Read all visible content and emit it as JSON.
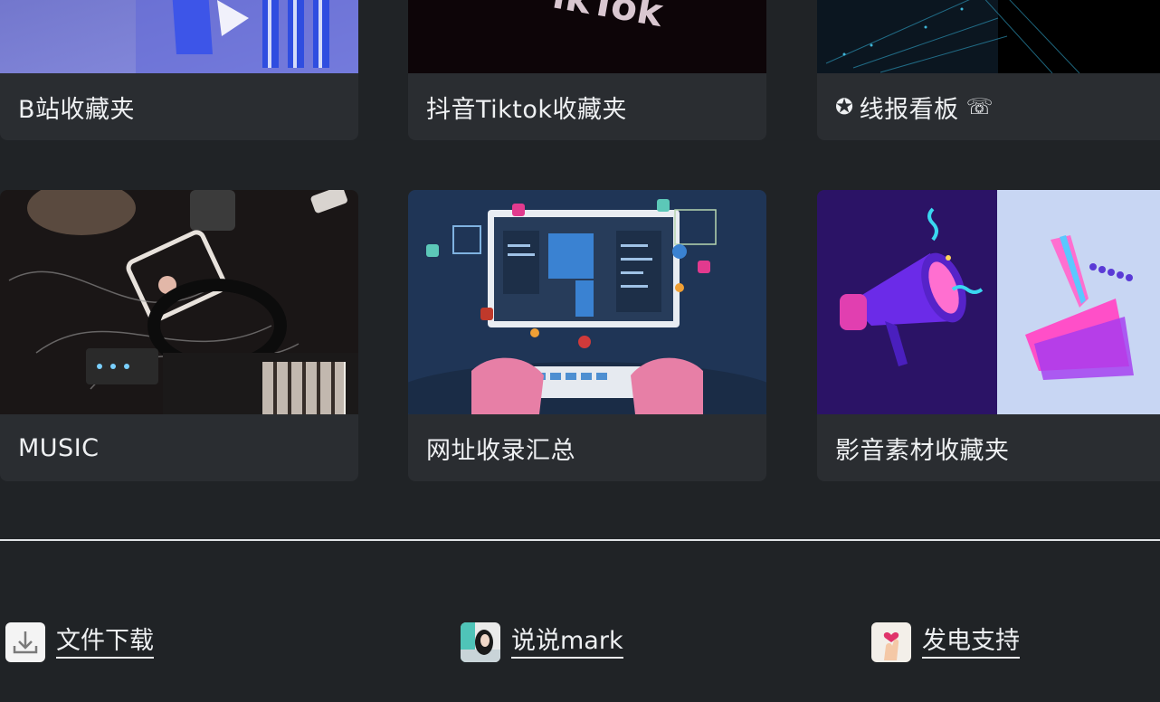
{
  "cards": [
    {
      "title": "B站收藏夹",
      "prefix_icon": "",
      "suffix_icon": ""
    },
    {
      "title": "抖音Tiktok收藏夹",
      "prefix_icon": "",
      "suffix_icon": ""
    },
    {
      "title": "线报看板",
      "prefix_icon": "✪",
      "suffix_icon": "☏"
    },
    {
      "title": "MUSIC",
      "prefix_icon": "",
      "suffix_icon": ""
    },
    {
      "title": "网址收录汇总",
      "prefix_icon": "",
      "suffix_icon": ""
    },
    {
      "title": "影音素材收藏夹",
      "prefix_icon": "",
      "suffix_icon": ""
    }
  ],
  "footer": {
    "links": [
      {
        "label": "文件下载",
        "icon": "download-icon"
      },
      {
        "label": "说说mark",
        "icon": "avatar-icon"
      },
      {
        "label": "发电支持",
        "icon": "heart-hand-icon"
      }
    ]
  },
  "colors": {
    "background": "#202326",
    "card": "#2a2d31",
    "text": "#eef0f2"
  }
}
